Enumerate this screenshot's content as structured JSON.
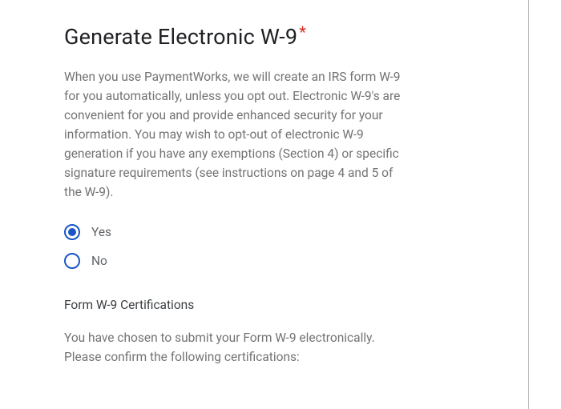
{
  "heading": {
    "title": "Generate Electronic W-9",
    "required_mark": "*"
  },
  "description": "When you use PaymentWorks, we will create an IRS form W-9 for you automatically, unless you opt out. Electronic W-9's are convenient for you and provide enhanced security for your information. You may wish to opt-out of electronic W-9 generation if you have any exemptions (Section 4) or specific signature requirements (see instructions on page 4 and 5 of the W-9).",
  "options": {
    "yes": {
      "label": "Yes",
      "selected": true
    },
    "no": {
      "label": "No",
      "selected": false
    }
  },
  "certifications": {
    "heading": "Form W-9 Certifications",
    "intro": "You have chosen to submit your Form W-9 electronically. Please confirm the following certifications:"
  }
}
